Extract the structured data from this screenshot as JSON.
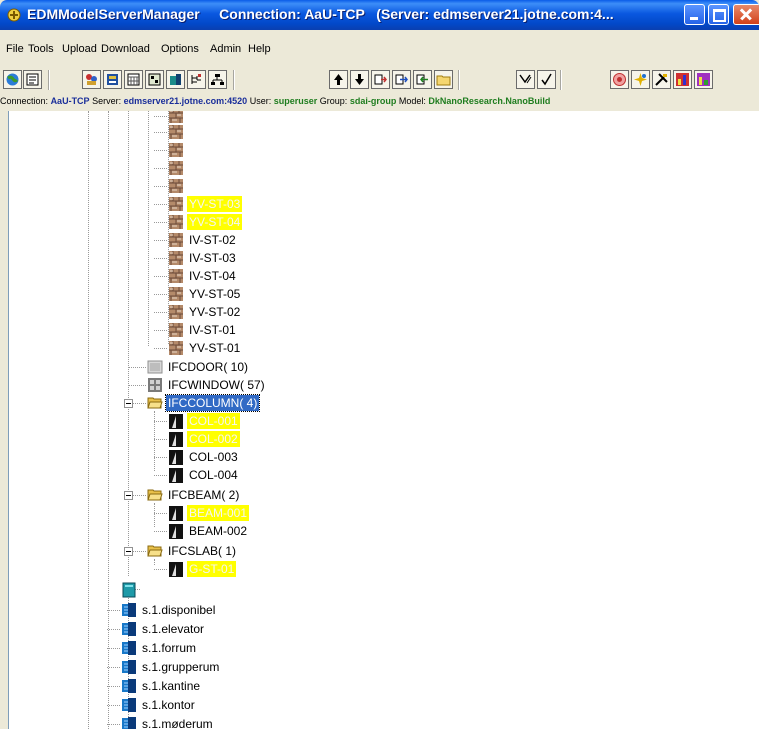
{
  "window": {
    "title": "EDMModelServerManager     Connection: AaU-TCP   (Server: edmserver21.jotne.com:4..."
  },
  "menu": [
    "File",
    "Tools",
    "Upload",
    "Download",
    "Options",
    "Admin",
    "Help"
  ],
  "status": {
    "connection_label": "Connection:",
    "connection": "AaU-TCP",
    "server_label": "Server:",
    "server": "edmserver21.jotne.com:4520",
    "user_label": "User:",
    "user": "superuser",
    "group_label": "Group:",
    "group": "sdai-group",
    "model_label": "Model:",
    "model": "DkNanoResearch.NanoBuild"
  },
  "tree": {
    "wall_items": [
      {
        "label": "YV-ST-03",
        "highlight": true
      },
      {
        "label": "YV-ST-04",
        "highlight": true
      },
      {
        "label": "IV-ST-02",
        "highlight": false
      },
      {
        "label": "IV-ST-03",
        "highlight": false
      },
      {
        "label": "IV-ST-04",
        "highlight": false
      },
      {
        "label": "YV-ST-05",
        "highlight": false
      },
      {
        "label": "YV-ST-02",
        "highlight": false
      },
      {
        "label": "IV-ST-01",
        "highlight": false
      },
      {
        "label": "YV-ST-01",
        "highlight": false
      }
    ],
    "door": "IFCDOOR( 10)",
    "window": "IFCWINDOW( 57)",
    "column": "IFCCOLUMN( 4)",
    "columns": [
      {
        "label": "COL-001",
        "highlight": true
      },
      {
        "label": "COL-002",
        "highlight": true
      },
      {
        "label": "COL-003",
        "highlight": false
      },
      {
        "label": "COL-004",
        "highlight": false
      }
    ],
    "beam": "IFCBEAM( 2)",
    "beams": [
      {
        "label": "BEAM-001",
        "highlight": true
      },
      {
        "label": "BEAM-002",
        "highlight": false
      }
    ],
    "slab": "IFCSLAB( 1)",
    "slabs": [
      {
        "label": "G-ST-01",
        "highlight": true
      }
    ],
    "spaces": [
      "s.1.disponibel",
      "s.1.elevator",
      "s.1.forrum",
      "s.1.grupperum",
      "s.1.kantine",
      "s.1.kontor",
      "s.1.møderum"
    ]
  }
}
